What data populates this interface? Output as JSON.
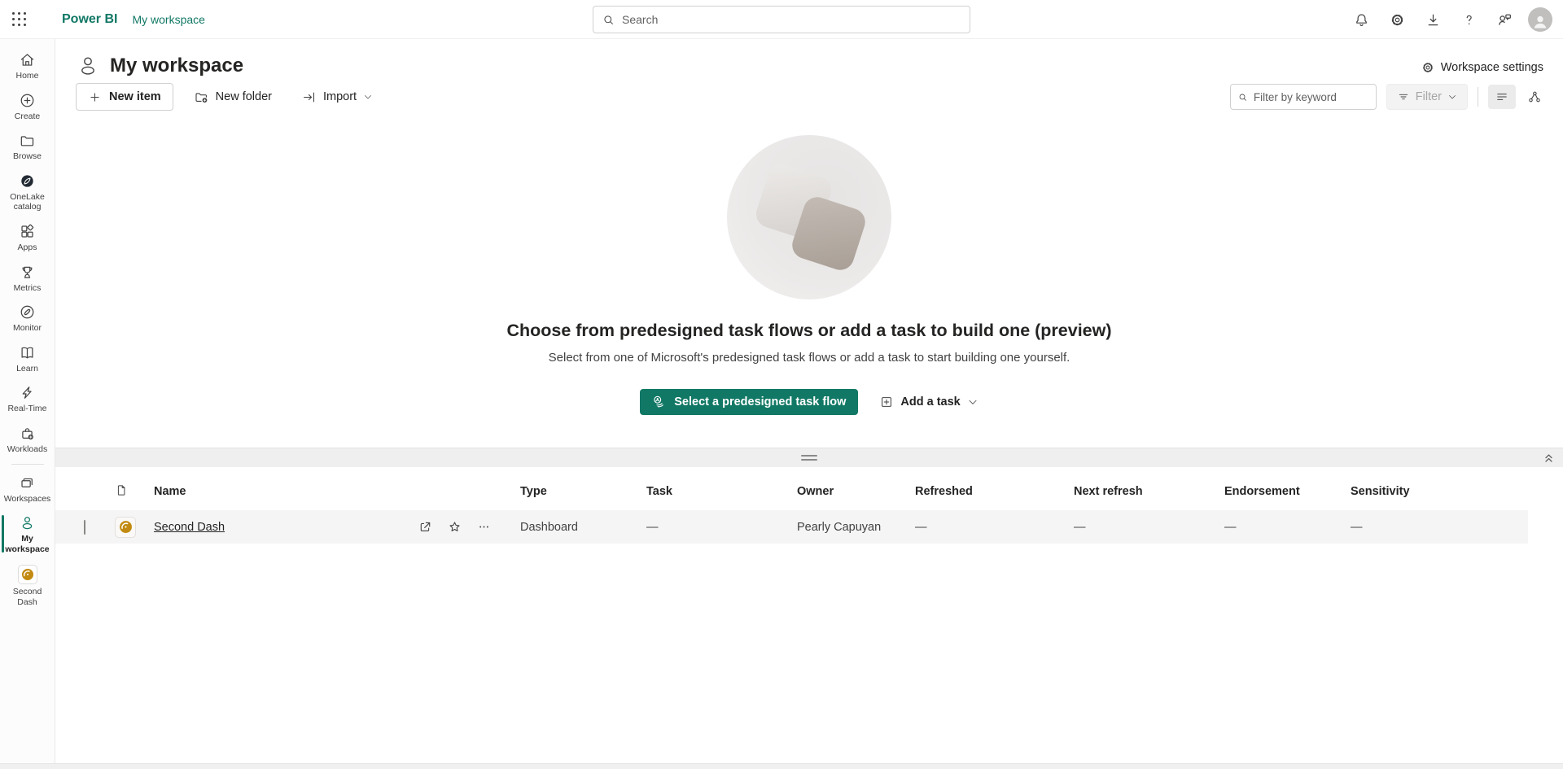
{
  "topbar": {
    "app_name": "Power BI",
    "breadcrumb": "My workspace",
    "search_placeholder": "Search",
    "icons": [
      "notifications",
      "settings",
      "download",
      "help",
      "feedback",
      "account"
    ]
  },
  "sidebar": {
    "items": [
      {
        "label": "Home",
        "icon": "home"
      },
      {
        "label": "Create",
        "icon": "plus-circle"
      },
      {
        "label": "Browse",
        "icon": "folder"
      },
      {
        "label": "OneLake catalog",
        "icon": "onelake"
      },
      {
        "label": "Apps",
        "icon": "apps"
      },
      {
        "label": "Metrics",
        "icon": "trophy"
      },
      {
        "label": "Monitor",
        "icon": "compass"
      },
      {
        "label": "Learn",
        "icon": "book"
      },
      {
        "label": "Real-Time",
        "icon": "bolt"
      },
      {
        "label": "Workloads",
        "icon": "bag-plus"
      },
      {
        "label": "Workspaces",
        "icon": "stack"
      },
      {
        "label": "My workspace",
        "icon": "person",
        "active": true
      },
      {
        "label": "Second Dash",
        "icon": "dashboard-gold"
      }
    ]
  },
  "page": {
    "title": "My workspace",
    "settings_label": "Workspace settings"
  },
  "toolbar": {
    "new_item": "New item",
    "new_folder": "New folder",
    "import_label": "Import",
    "filter_placeholder": "Filter by keyword",
    "filter_label": "Filter"
  },
  "empty_state": {
    "heading": "Choose from predesigned task flows or add a task to build one (preview)",
    "subtitle": "Select from one of Microsoft's predesigned task flows or add a task to start building one yourself.",
    "primary_button": "Select a predesigned task flow",
    "secondary_button": "Add a task"
  },
  "table": {
    "columns": [
      "Name",
      "Type",
      "Task",
      "Owner",
      "Refreshed",
      "Next refresh",
      "Endorsement",
      "Sensitivity"
    ],
    "rows": [
      {
        "name": "Second Dash",
        "type": "Dashboard",
        "task": "—",
        "owner": "Pearly Capuyan",
        "refreshed": "—",
        "next_refresh": "—",
        "endorsement": "—",
        "sensitivity": "—"
      }
    ]
  },
  "colors": {
    "brand": "#117865",
    "row_highlight": "#f5f5f5",
    "splitter_band": "#efefef",
    "dashboard_gold": "#c28a10"
  }
}
